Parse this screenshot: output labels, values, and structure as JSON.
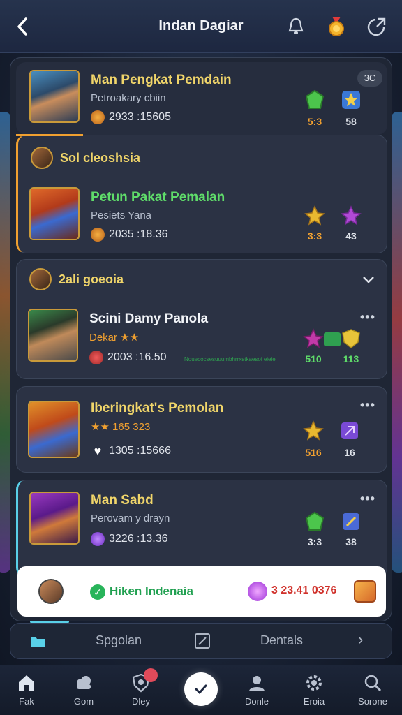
{
  "header": {
    "title": "Indan Dagiar"
  },
  "cards": [
    {
      "name": "Man Pengkat Pemdain",
      "sub": "Petroakary cbiin",
      "stat": "2933 :15605",
      "badge": "3C",
      "gems": [
        {
          "value": "5:3",
          "color": "#4cc54c"
        },
        {
          "value": "58",
          "color": "#3a78d6"
        }
      ]
    },
    {
      "group_title": "Sol cleoshsia",
      "name": "Petun Pakat Pemalan",
      "sub": "Pesiets Yana",
      "stat": "2035 :18.36",
      "gems": [
        {
          "value": "3:3",
          "color": "#e8b830"
        },
        {
          "value": "43",
          "color": "#b04ad6"
        }
      ]
    },
    {
      "group_title": "2ali goeoia",
      "name": "Scini Damy Panola",
      "sub": "Dekar ★★",
      "stat": "2003 :16.50",
      "tiny_note": "Nouecocsesuuumbhrrxstkaesoi eieie",
      "gems": [
        {
          "value": "510",
          "color": "#c23aa8"
        },
        {
          "value": "113",
          "color": "#e8c43a"
        }
      ]
    },
    {
      "name": "Iberingkat's Pemolan",
      "sub": "★★ 165 323",
      "stat": "1305 :15666",
      "gems": [
        {
          "value": "516",
          "color": "#e8b830"
        },
        {
          "value": "16",
          "color": "#7a4ad6"
        }
      ]
    },
    {
      "name": "Man Sabd",
      "sub": "Perovam y drayn",
      "stat": "3226 :13.36",
      "gems": [
        {
          "value": "3:3",
          "color": "#4cc54c"
        },
        {
          "value": "38",
          "color": "#4a6ad6"
        }
      ]
    }
  ],
  "invite": {
    "text": "Hiken Indenaia",
    "value": "3 23.41 0376"
  },
  "segbar": {
    "tab1": "Spgolan",
    "tab2": "Dentals"
  },
  "nav": [
    {
      "label": "Fak"
    },
    {
      "label": "Gom"
    },
    {
      "label": "Dley"
    },
    {
      "label": "Donle"
    },
    {
      "label": "Eroia"
    },
    {
      "label": "Sorone"
    }
  ],
  "colors": {
    "accent_gold": "#f0d56a",
    "accent_green": "#5fdc6a",
    "accent_orange": "#f0a030",
    "highlight_cyan": "#59d0e8"
  }
}
